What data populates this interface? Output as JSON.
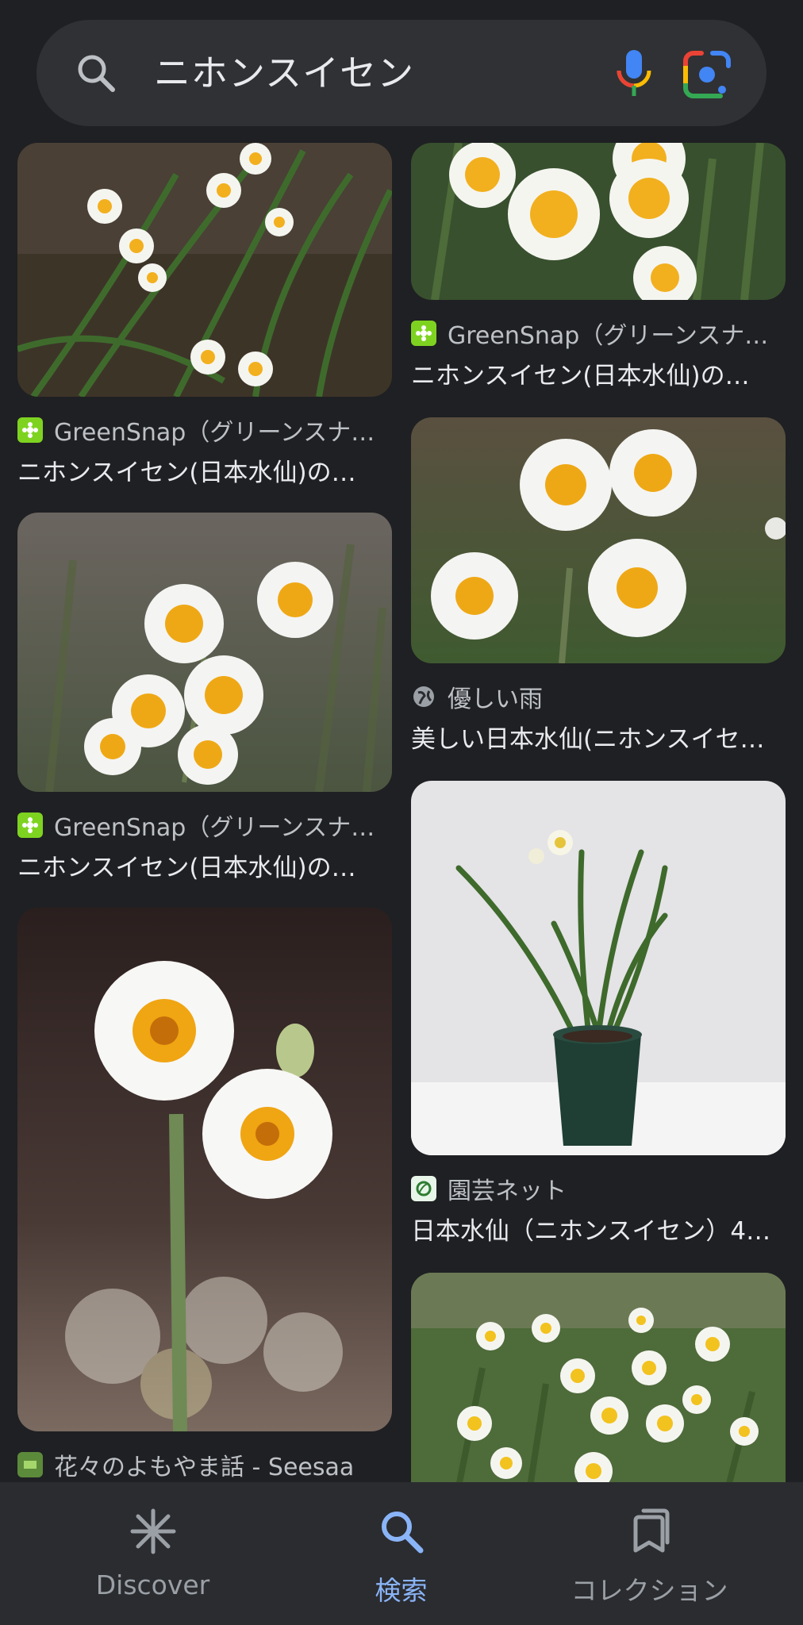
{
  "search": {
    "query": "ニホンスイセン",
    "icons": {
      "search": "search-icon",
      "mic": "mic-icon",
      "lens": "google-lens-icon"
    }
  },
  "results": [
    {
      "source": "GreenSnap（グリーンスナ…",
      "title": "ニホンスイセン(日本水仙)の…",
      "favicon": "greensnap-favicon"
    },
    {
      "source": "GreenSnap（グリーンスナ…",
      "title": "ニホンスイセン(日本水仙)の…",
      "favicon": "greensnap-favicon"
    },
    {
      "source": "GreenSnap（グリーンスナ…",
      "title": "ニホンスイセン(日本水仙)の…",
      "favicon": "greensnap-favicon"
    },
    {
      "source": "優しい雨",
      "title": "美しい日本水仙(ニホンスイセ…",
      "favicon": "globe-icon"
    },
    {
      "source": "花々のよもやま話 - Seesaa",
      "title": "",
      "favicon": "seesaa-favicon"
    },
    {
      "source": "園芸ネット",
      "title": "日本水仙（ニホンスイセン）4…",
      "favicon": "engei-net-favicon"
    }
  ],
  "bottom_nav": {
    "items": [
      {
        "label": "Discover",
        "icon": "asterisk-icon",
        "active": false
      },
      {
        "label": "検索",
        "icon": "search-icon",
        "active": true
      },
      {
        "label": "コレクション",
        "icon": "collections-icon",
        "active": false
      }
    ]
  },
  "colors": {
    "background": "#1f2023",
    "search_bar": "#303134",
    "active_nav": "#8ab4f8",
    "inactive_nav": "#9aa0a6"
  }
}
